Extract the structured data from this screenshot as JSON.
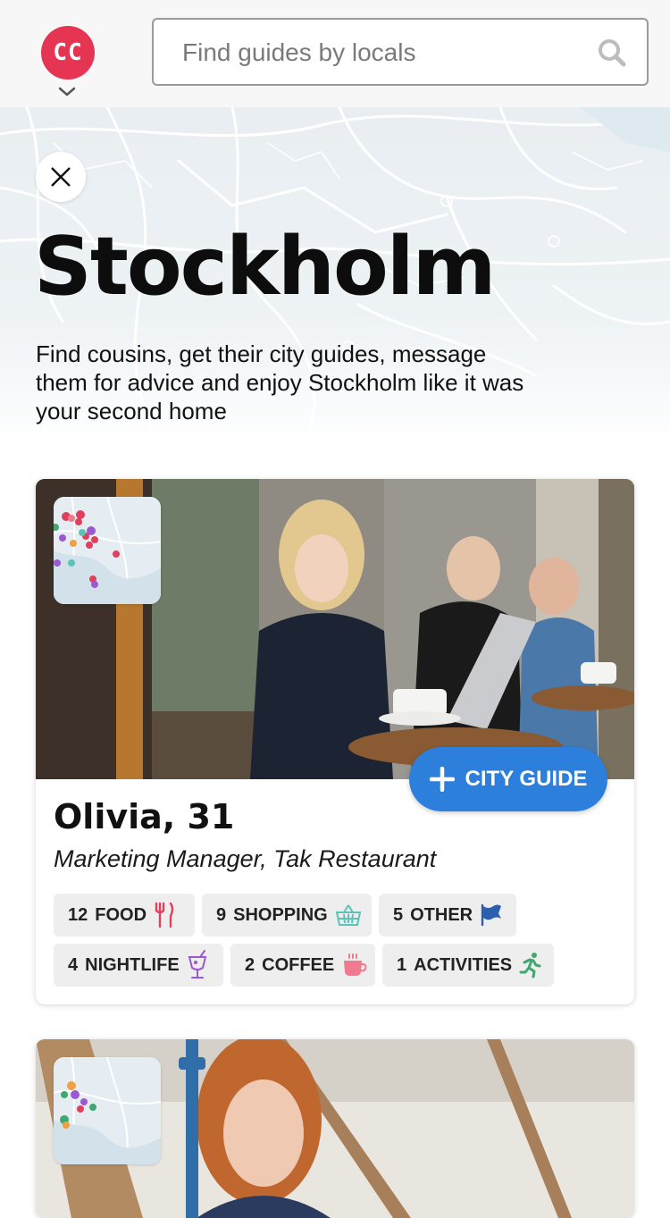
{
  "header": {
    "logo_text": "CC",
    "search_placeholder": "Find guides by locals"
  },
  "hero": {
    "city": "Stockholm",
    "description": "Find cousins, get their city guides, message them for advice and enjoy Stockholm like it was your second home"
  },
  "cards": [
    {
      "name": "Olivia, 31",
      "role": "Marketing Manager, Tak Restaurant",
      "button_label": "CITY GUIDE",
      "tags": [
        {
          "count": "12",
          "label": "FOOD",
          "icon": "fork-knife-icon",
          "color": "#e0405e"
        },
        {
          "count": "9",
          "label": "SHOPPING",
          "icon": "basket-icon",
          "color": "#5bc4b6"
        },
        {
          "count": "5",
          "label": "OTHER",
          "icon": "flag-icon",
          "color": "#2d5fb0"
        },
        {
          "count": "4",
          "label": "NIGHTLIFE",
          "icon": "cocktail-icon",
          "color": "#9b59d0"
        },
        {
          "count": "2",
          "label": "COFFEE",
          "icon": "coffee-cup-icon",
          "color": "#f07a8e"
        },
        {
          "count": "1",
          "label": "ACTIVITIES",
          "icon": "running-person-icon",
          "color": "#3fa870"
        }
      ]
    },
    {
      "name": "",
      "role": ""
    }
  ],
  "colors": {
    "brand": "#e63552",
    "accent": "#2d7fdc"
  }
}
